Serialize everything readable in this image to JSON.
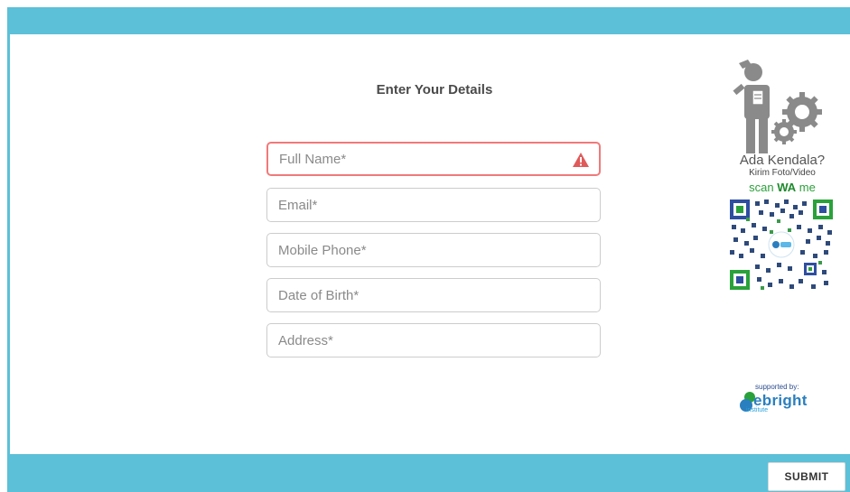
{
  "form": {
    "title": "Enter Your Details",
    "fields": [
      {
        "placeholder": "Full Name*",
        "value": "",
        "state": "error"
      },
      {
        "placeholder": "Email*",
        "value": ""
      },
      {
        "placeholder": "Mobile Phone*",
        "value": ""
      },
      {
        "placeholder": "Date of Birth*",
        "value": ""
      },
      {
        "placeholder": "Address*",
        "value": ""
      }
    ],
    "submit_label": "SUBMIT"
  },
  "help_widget": {
    "line1": "Ada Kendala?",
    "line2": "Kirim Foto/Video",
    "line3_prefix": "scan ",
    "line3_bold": "WA",
    "line3_suffix": " me",
    "figure_icon": "confused-person-gears-icon",
    "qr_icon": "whatsapp-qr-code"
  },
  "footer": {
    "supported_by": "supported by:",
    "brand_name": "ebright",
    "brand_sub": "institute"
  },
  "colors": {
    "accent": "#5bc0d8",
    "error_border": "#f07a7a",
    "warning_icon": "#e05a5a"
  }
}
